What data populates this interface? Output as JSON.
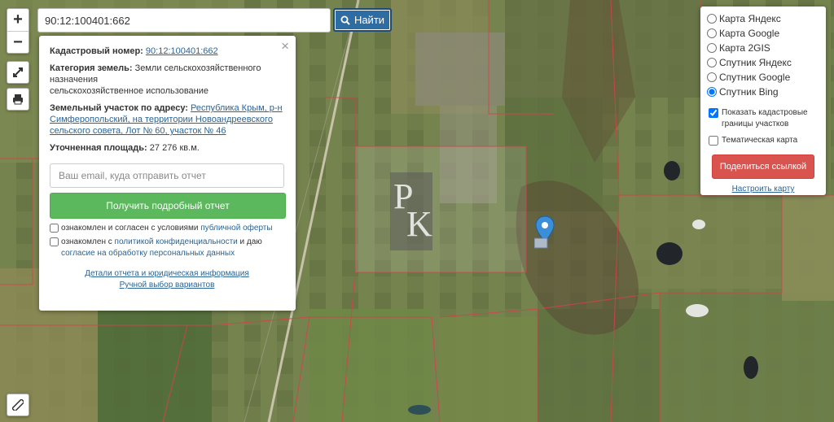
{
  "search": {
    "value": "90:12:100401:662",
    "button_label": "Найти"
  },
  "zoom": {
    "in_label": "+",
    "out_label": "−"
  },
  "tools": {
    "fullscreen_icon": "expand-icon",
    "print_icon": "printer-icon",
    "ruler_icon": "ruler-icon"
  },
  "info": {
    "close_label": "×",
    "cadastral_label": "Кадастровый номер:",
    "cadastral_value": "90:12:100401:662",
    "category_label": "Категория земель:",
    "category_value_1": "Земли сельскохозяйственного",
    "category_value_2": "назначения",
    "category_value_3": "сельскохозяйственное использование",
    "address_label": "Земельный участок по адресу:",
    "address_value_1": "Республика Крым, р-н",
    "address_value_2": "Симферопольский, на территории Новоандреевского",
    "address_value_3": "сельского совета, Лот № 60, участок № 46",
    "area_label": "Уточненная площадь:",
    "area_value": "27 276 кв.м.",
    "email_placeholder": "Ваш email, куда отправить отчет",
    "report_button": "Получить подробный отчет",
    "agree1_text": "ознакомлен и согласен с условиями",
    "agree1_link": "публичной оферты",
    "agree2_text_a": "ознакомлен с",
    "agree2_link_a": "политикой конфиденциальности",
    "agree2_text_b": "и даю",
    "agree2_link_b": "согласие на обработку персональных данных",
    "details_link": "Детали отчета и юридическая информация",
    "manual_link": "Ручной выбор вариантов"
  },
  "layers": {
    "options": [
      {
        "label": "Карта Яндекс",
        "checked": false
      },
      {
        "label": "Карта Google",
        "checked": false
      },
      {
        "label": "Карта 2GIS",
        "checked": false
      },
      {
        "label": "Спутник Яндекс",
        "checked": false
      },
      {
        "label": "Спутник Google",
        "checked": false
      },
      {
        "label": "Спутник Bing",
        "checked": true
      }
    ],
    "show_borders_label": "Показать кадастровые границы участков",
    "show_borders_checked": true,
    "thematic_label": "Тематическая карта",
    "thematic_checked": false,
    "share_button": "Поделиться ссылкой",
    "setup_link": "Настроить карту"
  },
  "watermark": {
    "letter_1": "P",
    "letter_2": "K"
  },
  "colors": {
    "search_button": "#2e6da4",
    "report_button": "#5cb85c",
    "share_button": "#d9534f",
    "marker": "#3a8fd8",
    "parcel_border": "#d8414a"
  }
}
